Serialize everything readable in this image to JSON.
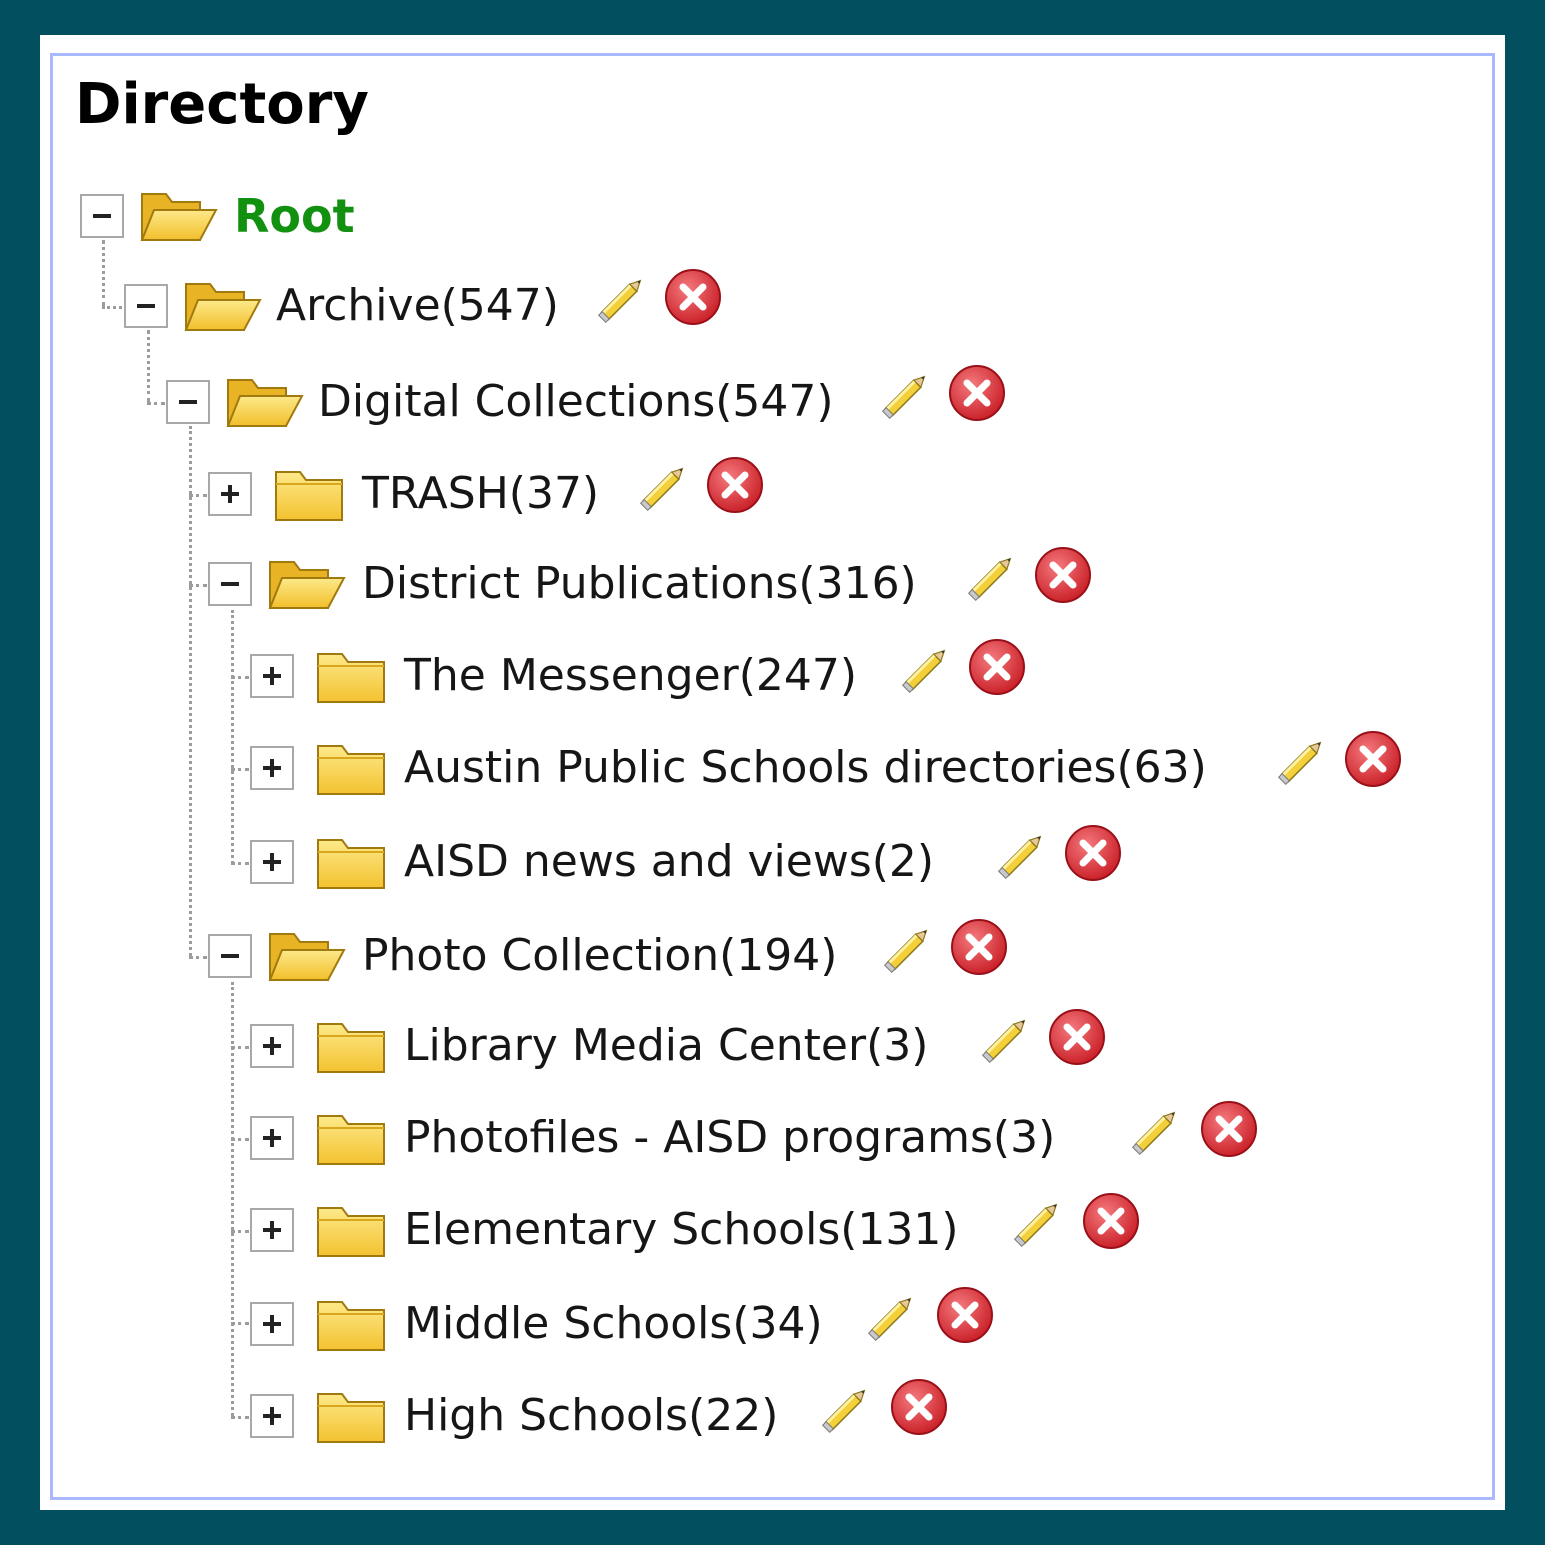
{
  "panel": {
    "title": "Directory"
  },
  "tree": [
    {
      "id": "root",
      "label": "Root",
      "state": "expanded",
      "actions": false,
      "open": true
    },
    {
      "id": "archive",
      "label": "Archive(547)",
      "state": "expanded",
      "actions": true,
      "open": true
    },
    {
      "id": "digital-collections",
      "label": "Digital Collections(547)",
      "state": "expanded",
      "actions": true,
      "open": true
    },
    {
      "id": "trash",
      "label": "TRASH(37)",
      "state": "collapsed",
      "actions": true,
      "open": false
    },
    {
      "id": "district-publications",
      "label": "District Publications(316)",
      "state": "expanded",
      "actions": true,
      "open": true
    },
    {
      "id": "the-messenger",
      "label": "The Messenger(247)",
      "state": "collapsed",
      "actions": true,
      "open": false
    },
    {
      "id": "austin-public-schools-directories",
      "label": "Austin Public Schools directories(63)",
      "state": "collapsed",
      "actions": true,
      "open": false
    },
    {
      "id": "aisd-news-and-views",
      "label": "AISD news and views(2)",
      "state": "collapsed",
      "actions": true,
      "open": false
    },
    {
      "id": "photo-collection",
      "label": "Photo Collection(194)",
      "state": "expanded",
      "actions": true,
      "open": true
    },
    {
      "id": "library-media-center",
      "label": "Library Media Center(3)",
      "state": "collapsed",
      "actions": true,
      "open": false
    },
    {
      "id": "photofiles-aisd-programs",
      "label": "Photofiles - AISD programs(3)",
      "state": "collapsed",
      "actions": true,
      "open": false
    },
    {
      "id": "elementary-schools",
      "label": "Elementary Schools(131)",
      "state": "collapsed",
      "actions": true,
      "open": false
    },
    {
      "id": "middle-schools",
      "label": "Middle Schools(34)",
      "state": "collapsed",
      "actions": true,
      "open": false
    },
    {
      "id": "high-schools",
      "label": "High Schools(22)",
      "state": "collapsed",
      "actions": true,
      "open": false
    }
  ],
  "icons": {
    "edit": "pencil-icon",
    "delete": "delete-icon",
    "folder_open": "folder-open-icon",
    "folder_closed": "folder-closed-icon"
  },
  "colors": {
    "frame": "#02505f",
    "panel_border": "#a9b9ff",
    "root_label": "#129010",
    "folder": "#f5c631",
    "delete": "#d7222a"
  }
}
